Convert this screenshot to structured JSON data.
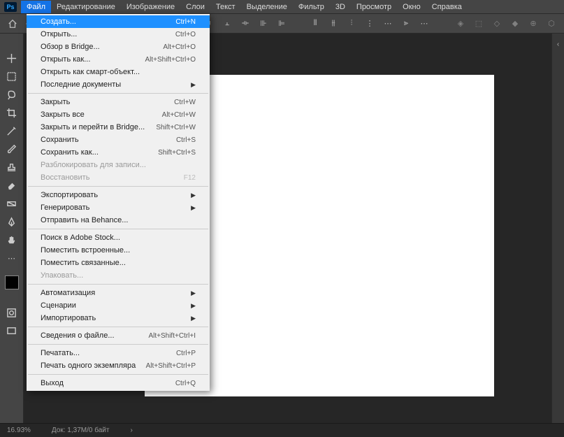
{
  "app": {
    "logo": "Ps"
  },
  "menubar": [
    "Файл",
    "Редактирование",
    "Изображение",
    "Слои",
    "Текст",
    "Выделение",
    "Фильтр",
    "3D",
    "Просмотр",
    "Окно",
    "Справка"
  ],
  "menubar_active_index": 0,
  "dropdown": {
    "groups": [
      [
        {
          "label": "Создать...",
          "shortcut": "Ctrl+N",
          "selected": true
        },
        {
          "label": "Открыть...",
          "shortcut": "Ctrl+O"
        },
        {
          "label": "Обзор в Bridge...",
          "shortcut": "Alt+Ctrl+O"
        },
        {
          "label": "Открыть как...",
          "shortcut": "Alt+Shift+Ctrl+O"
        },
        {
          "label": "Открыть как смарт-объект..."
        },
        {
          "label": "Последние документы",
          "submenu": true
        }
      ],
      [
        {
          "label": "Закрыть",
          "shortcut": "Ctrl+W"
        },
        {
          "label": "Закрыть все",
          "shortcut": "Alt+Ctrl+W"
        },
        {
          "label": "Закрыть и перейти в Bridge...",
          "shortcut": "Shift+Ctrl+W"
        },
        {
          "label": "Сохранить",
          "shortcut": "Ctrl+S"
        },
        {
          "label": "Сохранить как...",
          "shortcut": "Shift+Ctrl+S"
        },
        {
          "label": "Разблокировать для записи...",
          "disabled": true
        },
        {
          "label": "Восстановить",
          "shortcut": "F12",
          "disabled": true
        }
      ],
      [
        {
          "label": "Экспортировать",
          "submenu": true
        },
        {
          "label": "Генерировать",
          "submenu": true
        },
        {
          "label": "Отправить на Behance..."
        }
      ],
      [
        {
          "label": "Поиск в Adobe Stock..."
        },
        {
          "label": "Поместить встроенные..."
        },
        {
          "label": "Поместить связанные..."
        },
        {
          "label": "Упаковать...",
          "disabled": true
        }
      ],
      [
        {
          "label": "Автоматизация",
          "submenu": true
        },
        {
          "label": "Сценарии",
          "submenu": true
        },
        {
          "label": "Импортировать",
          "submenu": true
        }
      ],
      [
        {
          "label": "Сведения о файле...",
          "shortcut": "Alt+Shift+Ctrl+I"
        }
      ],
      [
        {
          "label": "Печатать...",
          "shortcut": "Ctrl+P"
        },
        {
          "label": "Печать одного экземпляра",
          "shortcut": "Alt+Shift+Ctrl+P"
        }
      ],
      [
        {
          "label": "Выход",
          "shortcut": "Ctrl+Q"
        }
      ]
    ]
  },
  "statusbar": {
    "zoom": "16.93%",
    "docinfo": "Док: 1,37М/0 байт",
    "arrow": "›"
  }
}
